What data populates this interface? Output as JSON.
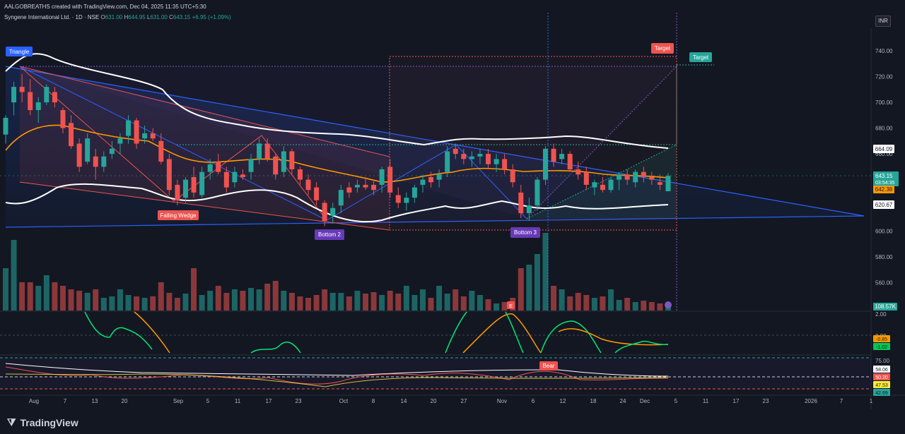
{
  "header": {
    "created_line": "AALGOBREATHS created with TradingView.com, Dec 04, 2025 11:35 UTC+5:30",
    "symbol_title": "Syngene International Ltd. · 1D · NSE",
    "o_label": "O",
    "o_value": "631.00",
    "h_label": "H",
    "h_value": "644.95",
    "l_label": "L",
    "l_value": "631.00",
    "c_label": "C",
    "c_value": "643.15",
    "change": "+6.95 (+1.09%)",
    "currency": "INR"
  },
  "chart_data": {
    "type": "candlestick",
    "price_ticks": [
      "740.00",
      "720.00",
      "700.00",
      "680.00",
      "660.00",
      "640.00",
      "620.00",
      "600.00",
      "580.00",
      "560.00"
    ],
    "x_labels": [
      "Aug",
      "7",
      "13",
      "20",
      "Sep",
      "5",
      "11",
      "17",
      "23",
      "Oct",
      "8",
      "14",
      "20",
      "27",
      "Nov",
      "6",
      "12",
      "18",
      "24",
      "Dec",
      "5",
      "11",
      "17",
      "23",
      "2026",
      "7",
      "1"
    ],
    "price_badges": {
      "upper_band": "664.09",
      "last_price": "643.15",
      "countdown": "03:54:35",
      "ma": "642.38",
      "lower_band": "620.67",
      "volume": "108.57K"
    },
    "annotations": {
      "triangle": "Triangle",
      "falling_wedge": "Falling Wedge",
      "bottom2": "Bottom 2",
      "bottom3": "Bottom 3",
      "target_red": "Target",
      "target_green": "Target",
      "bear": "Bear",
      "earnings": "E"
    },
    "osc1_ticks": [
      "2.00",
      "0.00"
    ],
    "osc1_badges": [
      "-0.85",
      "-1.02"
    ],
    "osc2_ticks": [
      "75.00"
    ],
    "osc2_badges": [
      "58.06",
      "50.20",
      "47.53",
      "42.69"
    ]
  },
  "footer": {
    "brand": "TradingView"
  },
  "colors": {
    "bg": "#131722",
    "up": "#26a69a",
    "down": "#ef5350",
    "band": "#ffffff",
    "ma": "#ff9800",
    "blue": "#2962ff"
  }
}
